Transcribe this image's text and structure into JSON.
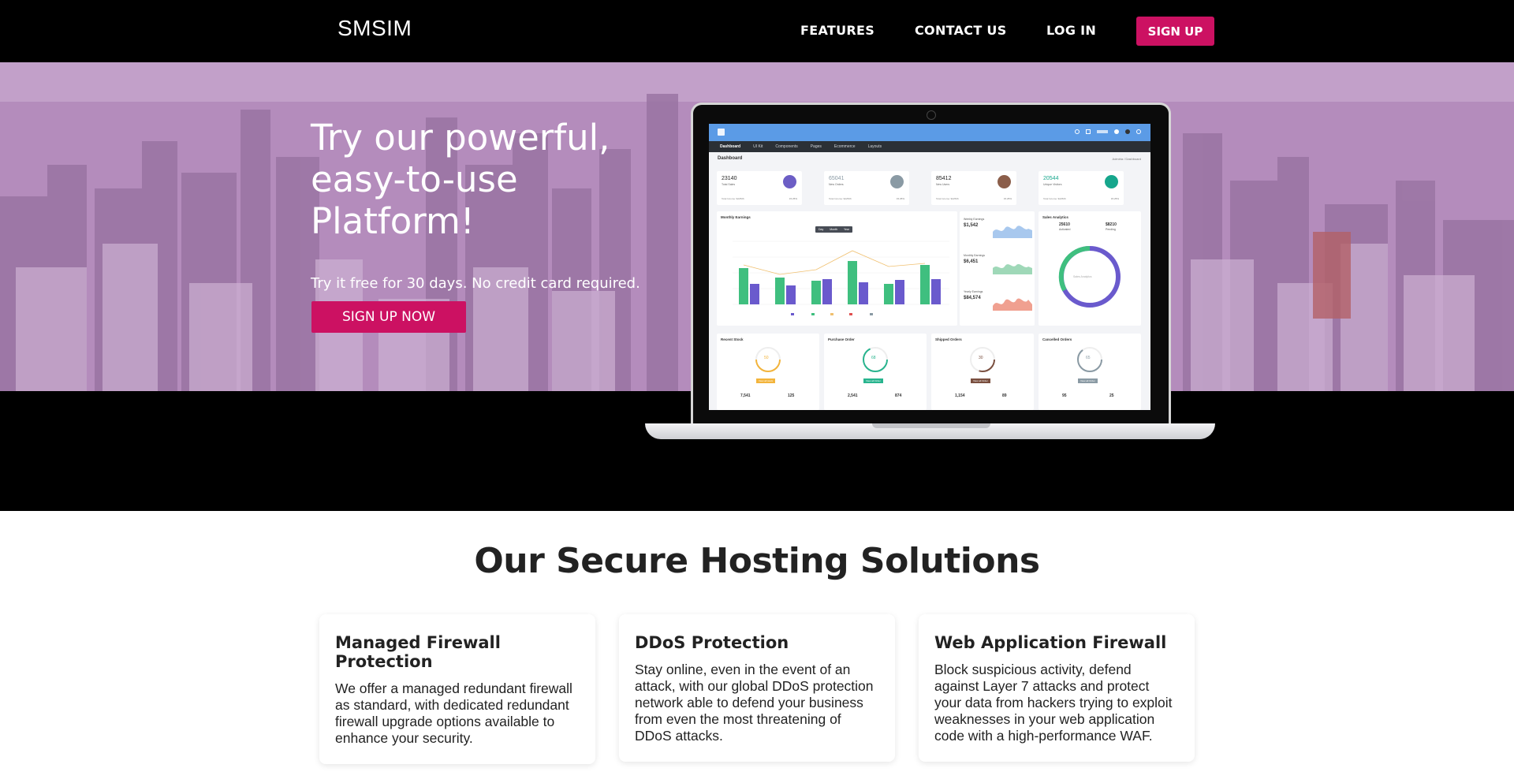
{
  "nav": {
    "brand": "SMSIM",
    "links": [
      "FEATURES",
      "CONTACT US",
      "LOG IN"
    ],
    "signup_label": "SIGN UP"
  },
  "hero": {
    "title": "Try our powerful, easy-to-use Platform!",
    "subtitle": "Try it free for 30 days. No credit card required.",
    "cta_label": "SIGN UP NOW"
  },
  "dashboard": {
    "menu": [
      "Dashboard",
      "UI Kit",
      "Components",
      "Pages",
      "Ecommerce",
      "Layouts"
    ],
    "page_title": "Dashboard",
    "crumb": "Admiria / Dashboard",
    "stats": [
      {
        "value": "23140",
        "label": "Total Sales",
        "foot": "Total Income: $22506",
        "pct": "15.25%",
        "color": "#6c5ec5"
      },
      {
        "value": "65041",
        "label": "New Orders",
        "foot": "Total Income: $22506",
        "pct": "15.25%",
        "color": "#8a9aa4"
      },
      {
        "value": "85412",
        "label": "New Users",
        "foot": "Total Income: $22506",
        "pct": "15.25%",
        "color": "#8b5e4a"
      },
      {
        "value": "20544",
        "label": "Unique Visitors",
        "foot": "Total Income: $22506",
        "pct": "15.25%",
        "color": "#16a68c"
      }
    ],
    "monthly_earnings_title": "Monthly Earnings",
    "tabs": [
      "Day",
      "Month",
      "Year"
    ],
    "side_earnings": [
      {
        "label": "Weekly Earnings",
        "value": "$1,542"
      },
      {
        "label": "Monthly Earnings",
        "value": "$6,451"
      },
      {
        "label": "Yearly Earnings",
        "value": "$84,574"
      }
    ],
    "sales_analytics": {
      "title": "Sales Analytics",
      "left_value": "25610",
      "left_label": "Activated",
      "right_value": "$8210",
      "right_label": "Pending",
      "center": "Sales Analytics"
    },
    "bottom_panels": [
      {
        "title": "Recent Stock",
        "value": "50",
        "badge": "View all stock",
        "color": "#f3b43b",
        "left": "7,541",
        "right": "125"
      },
      {
        "title": "Purchase Order",
        "value": "68",
        "badge": "View all Order",
        "color": "#28b48e",
        "left": "2,541",
        "right": "874"
      },
      {
        "title": "Shipped Orders",
        "value": "30",
        "badge": "View all Order",
        "color": "#7a4f3f",
        "left": "1,154",
        "right": "89"
      },
      {
        "title": "Cancelled Orders",
        "value": "65",
        "badge": "View all Order",
        "color": "#8a9aa4",
        "left": "95",
        "right": "25"
      }
    ]
  },
  "section": {
    "title": "Our Secure Hosting Solutions",
    "cards": [
      {
        "title": "Managed Firewall Protection",
        "text": "We offer a managed redundant firewall as standard, with dedicated redundant firewall upgrade options available to enhance your security."
      },
      {
        "title": "DDoS Protection",
        "text": "Stay online, even in the event of an attack, with our global DDoS protection network able to defend your business from even the most threatening of DDoS attacks."
      },
      {
        "title": "Web Application Firewall",
        "text": "Block suspicious activity, defend against Layer 7 attacks and protect your data from hackers trying to exploit weaknesses in your web application code with a high-performance WAF."
      }
    ]
  },
  "colors": {
    "accent": "#cc1162",
    "nav_bg": "#000000",
    "hero_tint": "#b48cbc"
  }
}
